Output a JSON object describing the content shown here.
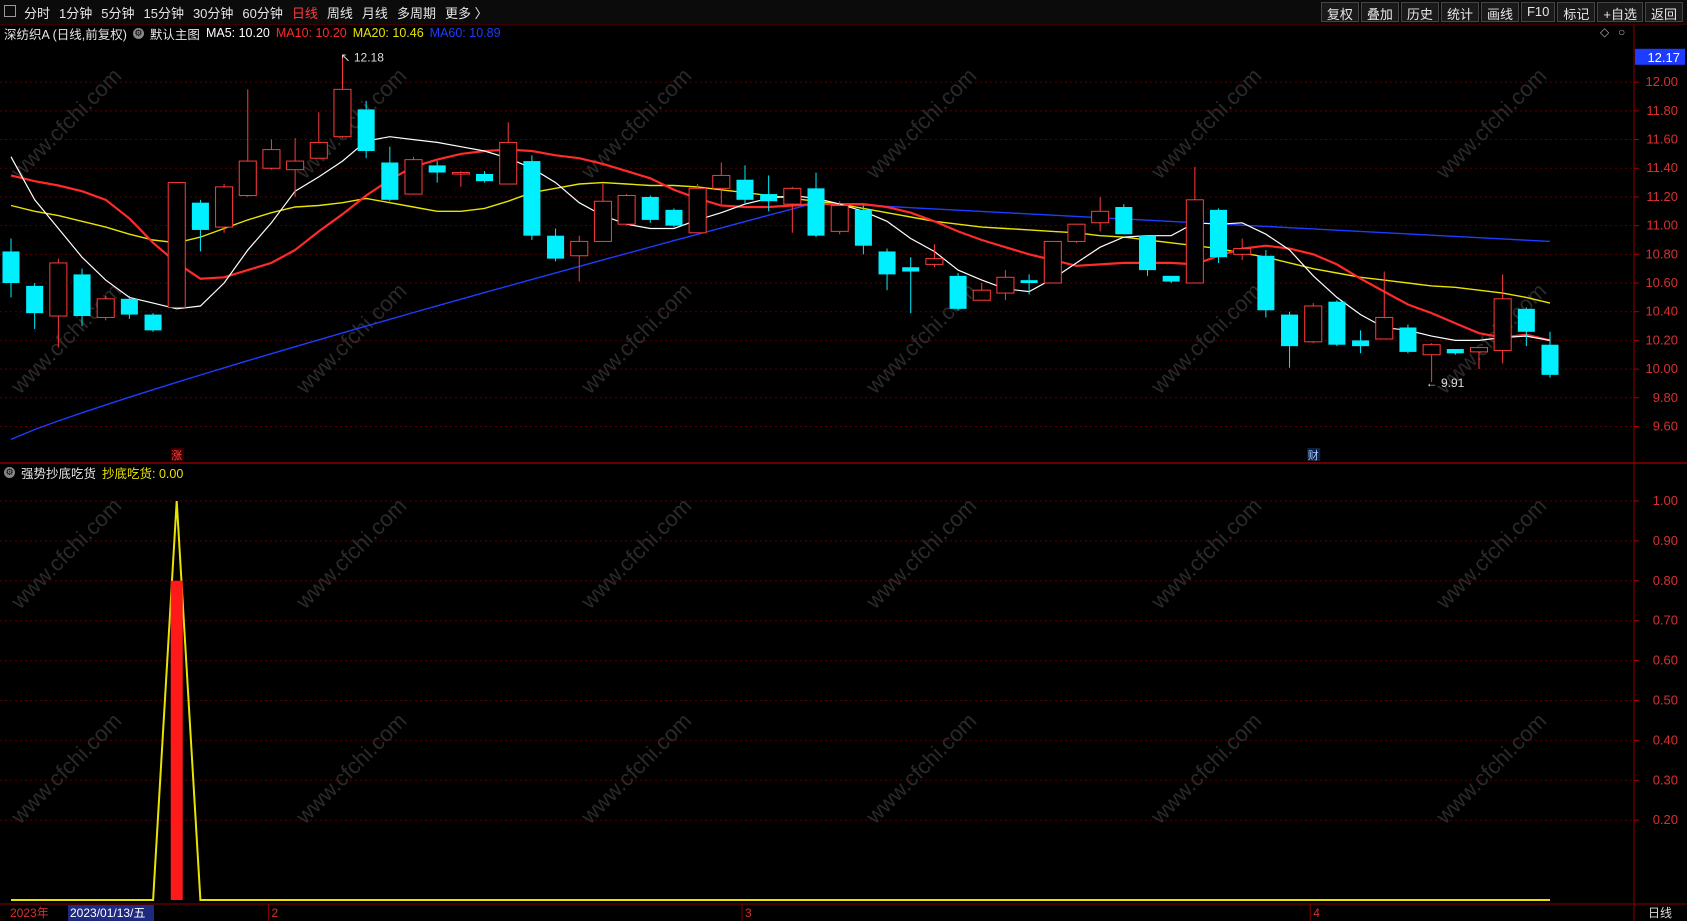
{
  "toolbar": {
    "periods": [
      "分时",
      "1分钟",
      "5分钟",
      "15分钟",
      "30分钟",
      "60分钟",
      "日线",
      "周线",
      "月线",
      "多周期",
      "更多 〉"
    ],
    "active_period": "日线",
    "tools": [
      "复权",
      "叠加",
      "历史",
      "统计",
      "画线",
      "F10",
      "标记",
      "+自选",
      "返回"
    ]
  },
  "main_info": {
    "stock": "深纺织A (日线,前复权)",
    "template": "默认主图",
    "ma5": "MA5: 10.20",
    "ma10": "MA10: 10.20",
    "ma20": "MA20: 10.46",
    "ma60": "MA60: 10.89",
    "price_tag": "12.17",
    "high_label": "12.18",
    "low_label": "9.91",
    "marker_zhang": "涨",
    "marker_cai": "财",
    "colors": {
      "ma5": "#ffffff",
      "ma10": "#ff2a2a",
      "ma20": "#e8e400",
      "ma60": "#1e3cff",
      "up": "#ff3b3b",
      "down": "#00f0ff"
    }
  },
  "sub_info": {
    "indicator": "强势抄底吃货",
    "value": "抄底吃货: 0.00"
  },
  "price_axis": [
    "12.00",
    "11.80",
    "11.60",
    "11.40",
    "11.20",
    "11.00",
    "10.80",
    "10.60",
    "10.40",
    "10.20",
    "10.00",
    "9.80",
    "9.60"
  ],
  "sub_axis": [
    "1.00",
    "0.90",
    "0.80",
    "0.70",
    "0.60",
    "0.50",
    "0.40",
    "0.30",
    "0.20"
  ],
  "date_axis": {
    "year": "2023年",
    "cursor_date": "2023/01/13/五",
    "months": [
      "2",
      "3",
      "4"
    ]
  },
  "period_label": "日线",
  "watermark": "www.cfchi.com",
  "chart_data": {
    "type": "candlestick",
    "ylim": [
      9.45,
      12.28
    ],
    "candles": [
      [
        10.82,
        10.6,
        10.91,
        10.5
      ],
      [
        10.58,
        10.39,
        10.6,
        10.28
      ],
      [
        10.37,
        10.74,
        10.77,
        10.15
      ],
      [
        10.66,
        10.37,
        10.7,
        10.3
      ],
      [
        10.36,
        10.49,
        10.51,
        10.34
      ],
      [
        10.49,
        10.38,
        10.51,
        10.35
      ],
      [
        10.38,
        10.27,
        10.39,
        10.26
      ],
      [
        10.43,
        11.3,
        11.3,
        10.43
      ],
      [
        11.16,
        10.97,
        11.18,
        10.82
      ],
      [
        10.99,
        11.27,
        11.29,
        10.95
      ],
      [
        11.21,
        11.45,
        11.95,
        11.2
      ],
      [
        11.4,
        11.53,
        11.6,
        11.39
      ],
      [
        11.39,
        11.45,
        11.61,
        11.2
      ],
      [
        11.47,
        11.58,
        11.79,
        11.49
      ],
      [
        11.62,
        11.95,
        12.18,
        11.61
      ],
      [
        11.81,
        11.52,
        11.87,
        11.47
      ],
      [
        11.44,
        11.18,
        11.55,
        11.17
      ],
      [
        11.22,
        11.46,
        11.48,
        11.22
      ],
      [
        11.42,
        11.37,
        11.45,
        11.3
      ],
      [
        11.36,
        11.37,
        11.38,
        11.27
      ],
      [
        11.36,
        11.31,
        11.38,
        11.3
      ],
      [
        11.29,
        11.58,
        11.72,
        11.29
      ],
      [
        11.45,
        10.93,
        11.49,
        10.9
      ],
      [
        10.93,
        10.77,
        10.98,
        10.75
      ],
      [
        10.79,
        10.89,
        10.93,
        10.61
      ],
      [
        10.89,
        11.17,
        11.29,
        10.89
      ],
      [
        11.01,
        11.21,
        11.22,
        11.0
      ],
      [
        11.2,
        11.04,
        11.21,
        11.02
      ],
      [
        11.11,
        11.0,
        11.12,
        10.99
      ],
      [
        10.95,
        11.26,
        11.29,
        10.95
      ],
      [
        11.26,
        11.35,
        11.44,
        11.15
      ],
      [
        11.32,
        11.18,
        11.42,
        11.15
      ],
      [
        11.22,
        11.17,
        11.35,
        11.1
      ],
      [
        11.15,
        11.26,
        11.27,
        10.95
      ],
      [
        11.26,
        10.93,
        11.37,
        10.92
      ],
      [
        10.96,
        11.14,
        11.17,
        10.94
      ],
      [
        11.11,
        10.86,
        11.14,
        10.8
      ],
      [
        10.82,
        10.66,
        10.84,
        10.55
      ],
      [
        10.71,
        10.68,
        10.78,
        10.39
      ],
      [
        10.73,
        10.77,
        10.87,
        10.71
      ],
      [
        10.65,
        10.42,
        10.67,
        10.41
      ],
      [
        10.48,
        10.55,
        10.6,
        10.48
      ],
      [
        10.53,
        10.64,
        10.69,
        10.48
      ],
      [
        10.62,
        10.6,
        10.66,
        10.52
      ],
      [
        10.6,
        10.89,
        10.89,
        10.6
      ],
      [
        10.89,
        11.01,
        11.01,
        10.88
      ],
      [
        11.02,
        11.1,
        11.2,
        10.96
      ],
      [
        11.13,
        10.94,
        11.15,
        10.94
      ],
      [
        10.93,
        10.69,
        10.93,
        10.65
      ],
      [
        10.65,
        10.61,
        10.65,
        10.6
      ],
      [
        10.6,
        11.18,
        11.41,
        10.6
      ],
      [
        11.11,
        10.78,
        11.12,
        10.74
      ],
      [
        10.8,
        10.84,
        10.91,
        10.76
      ],
      [
        10.79,
        10.41,
        10.83,
        10.36
      ],
      [
        10.38,
        10.16,
        10.4,
        10.01
      ],
      [
        10.19,
        10.44,
        10.46,
        10.18
      ],
      [
        10.47,
        10.17,
        10.48,
        10.16
      ],
      [
        10.2,
        10.16,
        10.27,
        10.11
      ],
      [
        10.21,
        10.36,
        10.68,
        10.21
      ],
      [
        10.29,
        10.12,
        10.31,
        10.11
      ],
      [
        10.1,
        10.17,
        10.18,
        9.91
      ],
      [
        10.14,
        10.11,
        10.14,
        10.1
      ],
      [
        10.12,
        10.15,
        10.15,
        10.0
      ],
      [
        10.13,
        10.49,
        10.66,
        10.04
      ],
      [
        10.42,
        10.26,
        10.43,
        10.16
      ],
      [
        10.17,
        9.96,
        10.26,
        9.94
      ]
    ],
    "ma5": [
      11.48,
      11.18,
      10.98,
      10.78,
      10.62,
      10.5,
      10.46,
      10.42,
      10.44,
      10.6,
      10.83,
      11.02,
      11.24,
      11.34,
      11.45,
      11.59,
      11.62,
      11.6,
      11.58,
      11.55,
      11.52,
      11.47,
      11.4,
      11.3,
      11.16,
      11.07,
      11.01,
      10.98,
      10.98,
      11.04,
      11.09,
      11.15,
      11.19,
      11.21,
      11.19,
      11.15,
      11.1,
      11.03,
      10.91,
      10.82,
      10.69,
      10.62,
      10.56,
      10.54,
      10.63,
      10.74,
      10.85,
      10.92,
      10.93,
      10.93,
      11.02,
      11.01,
      11.02,
      10.94,
      10.83,
      10.65,
      10.5,
      10.38,
      10.29,
      10.27,
      10.23,
      10.2,
      10.2,
      10.22,
      10.23,
      10.2
    ],
    "ma10": [
      11.35,
      11.31,
      11.28,
      11.24,
      11.18,
      11.05,
      10.88,
      10.74,
      10.63,
      10.64,
      10.69,
      10.74,
      10.83,
      10.96,
      11.08,
      11.21,
      11.32,
      11.41,
      11.46,
      11.5,
      11.52,
      11.53,
      11.52,
      11.49,
      11.47,
      11.43,
      11.38,
      11.33,
      11.25,
      11.19,
      11.14,
      11.13,
      11.13,
      11.14,
      11.15,
      11.15,
      11.15,
      11.13,
      11.09,
      11.03,
      10.96,
      10.9,
      10.85,
      10.8,
      10.76,
      10.72,
      10.73,
      10.74,
      10.74,
      10.74,
      10.73,
      10.79,
      10.84,
      10.86,
      10.84,
      10.8,
      10.73,
      10.63,
      10.54,
      10.45,
      10.39,
      10.32,
      10.25,
      10.22,
      10.24,
      10.2
    ],
    "ma20": [
      11.14,
      11.1,
      11.07,
      11.03,
      10.99,
      10.94,
      10.9,
      10.88,
      10.92,
      10.98,
      11.04,
      11.09,
      11.13,
      11.14,
      11.16,
      11.19,
      11.16,
      11.13,
      11.1,
      11.1,
      11.12,
      11.17,
      11.23,
      11.26,
      11.29,
      11.3,
      11.29,
      11.28,
      11.28,
      11.27,
      11.25,
      11.23,
      11.21,
      11.19,
      11.17,
      11.15,
      11.12,
      11.09,
      11.06,
      11.03,
      11.01,
      10.99,
      10.98,
      10.97,
      10.96,
      10.95,
      10.93,
      10.92,
      10.9,
      10.88,
      10.86,
      10.84,
      10.81,
      10.78,
      10.74,
      10.7,
      10.67,
      10.64,
      10.62,
      10.6,
      10.58,
      10.57,
      10.55,
      10.53,
      10.5,
      10.46
    ],
    "ma60_start": 9.51,
    "ma60_peak": 11.16,
    "ma60_end": 10.89,
    "sub": {
      "ylim": [
        0,
        1.05
      ],
      "line_peak": 1.0,
      "bar_value": 0.8,
      "peak_index": 7,
      "current": 0.0
    }
  }
}
